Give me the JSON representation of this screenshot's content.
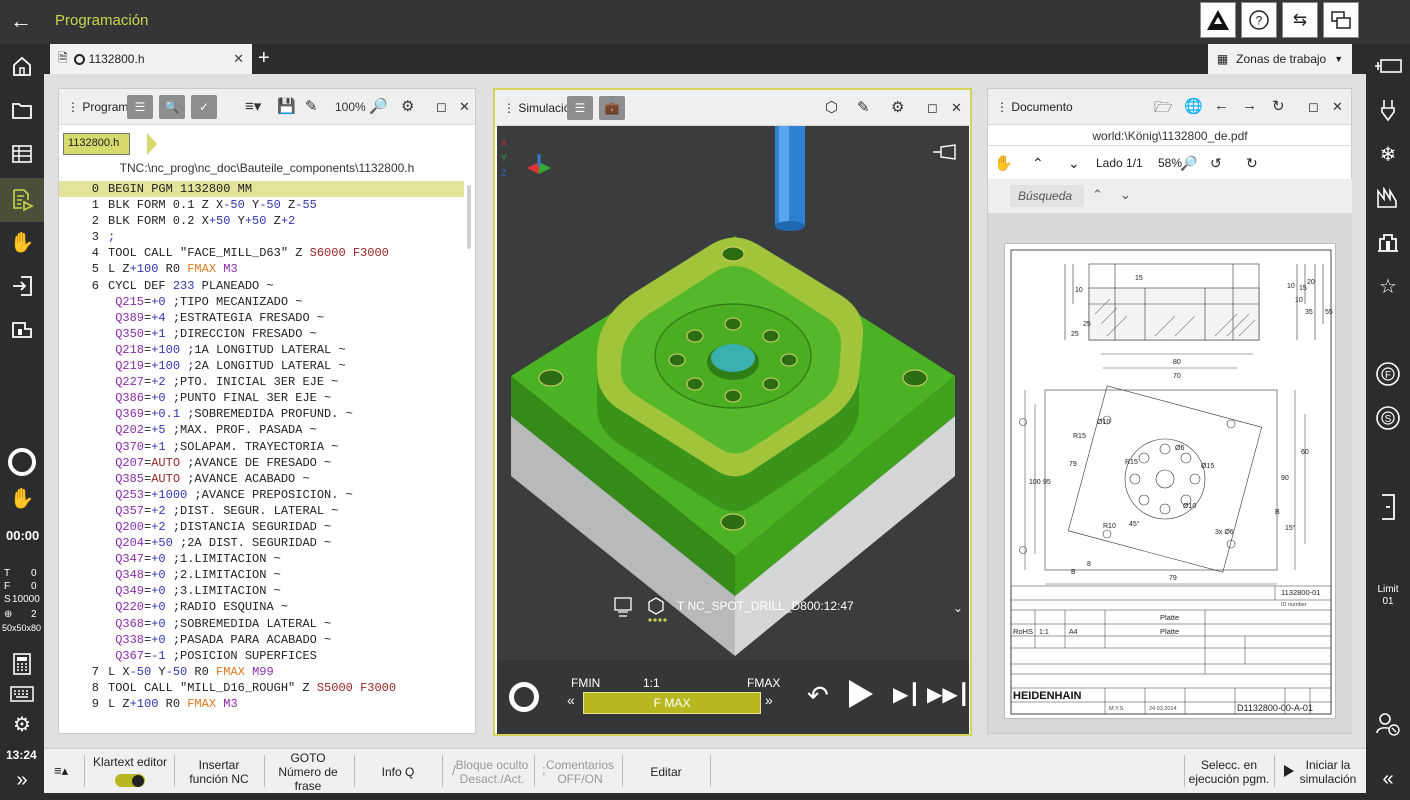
{
  "app": {
    "title": "Programación"
  },
  "topbar": {
    "icons": [
      "warning-triangle-icon",
      "help-icon",
      "transfer-icon",
      "windows-icon"
    ]
  },
  "left_sidebar": {
    "icons": [
      "home-icon",
      "folder-icon",
      "table-icon",
      "editor-icon",
      "hand-icon",
      "run-icon",
      "machine-icon"
    ],
    "timer": "00:00",
    "status": {
      "t_label": "T",
      "t_val": "0",
      "f_label": "F",
      "f_val": "0",
      "s_label": "S",
      "s_val": "10000",
      "blk_icon": "⊕",
      "blk_val": "2",
      "blk_dims": "50x50x80"
    },
    "clock": "13:24"
  },
  "right_sidebar": {
    "limit_label": "Limit",
    "limit_value": "01"
  },
  "tabs": [
    {
      "label": "1132800.h"
    }
  ],
  "workzones": {
    "label": "Zonas de trabajo"
  },
  "program_panel": {
    "title": "Programa",
    "zoom": "100%",
    "breadcrumb": "1132800.h",
    "path": "TNC:\\nc_prog\\nc_doc\\Bauteile_components\\1132800.h",
    "lines": [
      {
        "n": "0",
        "segs": [
          [
            "k",
            "BEGIN PGM 1132800 MM"
          ]
        ],
        "hl": true
      },
      {
        "n": "1",
        "segs": [
          [
            "k",
            "BLK FORM 0.1 Z X"
          ],
          [
            "b",
            "-50"
          ],
          [
            "k",
            " Y"
          ],
          [
            "b",
            "-50"
          ],
          [
            "k",
            " Z"
          ],
          [
            "b",
            "-55"
          ]
        ]
      },
      {
        "n": "2",
        "segs": [
          [
            "k",
            "BLK FORM 0.2 X"
          ],
          [
            "b",
            "+50"
          ],
          [
            "k",
            " Y"
          ],
          [
            "b",
            "+50"
          ],
          [
            "k",
            " Z"
          ],
          [
            "b",
            "+2"
          ]
        ]
      },
      {
        "n": "3",
        "segs": [
          [
            "b",
            ";"
          ]
        ]
      },
      {
        "n": "4",
        "segs": [
          [
            "k",
            "TOOL CALL \"FACE_MILL_D63\" Z "
          ],
          [
            "r",
            "S6000"
          ],
          [
            "k",
            " "
          ],
          [
            "r",
            "F3000"
          ]
        ]
      },
      {
        "n": "5",
        "segs": [
          [
            "k",
            "L Z"
          ],
          [
            "b",
            "+100"
          ],
          [
            "k",
            " R0 "
          ],
          [
            "o",
            "FMAX"
          ],
          [
            "k",
            " "
          ],
          [
            "p",
            "M3"
          ]
        ]
      },
      {
        "n": "6",
        "segs": [
          [
            "k",
            "CYCL DEF "
          ],
          [
            "b",
            "233"
          ],
          [
            "k",
            " PLANEADO ~"
          ]
        ]
      },
      {
        "n": "",
        "segs": [
          [
            "k",
            " "
          ],
          [
            "p",
            "Q215"
          ],
          [
            "k",
            "="
          ],
          [
            "b",
            "+0"
          ],
          [
            "k",
            " ;TIPO MECANIZADO ~"
          ]
        ]
      },
      {
        "n": "",
        "segs": [
          [
            "k",
            " "
          ],
          [
            "p",
            "Q389"
          ],
          [
            "k",
            "="
          ],
          [
            "b",
            "+4"
          ],
          [
            "k",
            " ;ESTRATEGIA FRESADO ~"
          ]
        ]
      },
      {
        "n": "",
        "segs": [
          [
            "k",
            " "
          ],
          [
            "p",
            "Q350"
          ],
          [
            "k",
            "="
          ],
          [
            "b",
            "+1"
          ],
          [
            "k",
            " ;DIRECCION FRESADO ~"
          ]
        ]
      },
      {
        "n": "",
        "segs": [
          [
            "k",
            " "
          ],
          [
            "p",
            "Q218"
          ],
          [
            "k",
            "="
          ],
          [
            "b",
            "+100"
          ],
          [
            "k",
            " ;1A LONGITUD LATERAL ~"
          ]
        ]
      },
      {
        "n": "",
        "segs": [
          [
            "k",
            " "
          ],
          [
            "p",
            "Q219"
          ],
          [
            "k",
            "="
          ],
          [
            "b",
            "+100"
          ],
          [
            "k",
            " ;2A LONGITUD LATERAL ~"
          ]
        ]
      },
      {
        "n": "",
        "segs": [
          [
            "k",
            " "
          ],
          [
            "p",
            "Q227"
          ],
          [
            "k",
            "="
          ],
          [
            "b",
            "+2"
          ],
          [
            "k",
            " ;PTO. INICIAL 3ER EJE ~"
          ]
        ]
      },
      {
        "n": "",
        "segs": [
          [
            "k",
            " "
          ],
          [
            "p",
            "Q386"
          ],
          [
            "k",
            "="
          ],
          [
            "b",
            "+0"
          ],
          [
            "k",
            " ;PUNTO FINAL 3ER EJE ~"
          ]
        ]
      },
      {
        "n": "",
        "segs": [
          [
            "k",
            " "
          ],
          [
            "p",
            "Q369"
          ],
          [
            "k",
            "="
          ],
          [
            "b",
            "+0.1"
          ],
          [
            "k",
            " ;SOBREMEDIDA PROFUND. ~"
          ]
        ]
      },
      {
        "n": "",
        "segs": [
          [
            "k",
            " "
          ],
          [
            "p",
            "Q202"
          ],
          [
            "k",
            "="
          ],
          [
            "b",
            "+5"
          ],
          [
            "k",
            " ;MAX. PROF. PASADA ~"
          ]
        ]
      },
      {
        "n": "",
        "segs": [
          [
            "k",
            " "
          ],
          [
            "p",
            "Q370"
          ],
          [
            "k",
            "="
          ],
          [
            "b",
            "+1"
          ],
          [
            "k",
            " ;SOLAPAM. TRAYECTORIA ~"
          ]
        ]
      },
      {
        "n": "",
        "segs": [
          [
            "k",
            " "
          ],
          [
            "p",
            "Q207"
          ],
          [
            "k",
            "="
          ],
          [
            "r",
            "AUTO"
          ],
          [
            "k",
            " ;AVANCE DE FRESADO ~"
          ]
        ]
      },
      {
        "n": "",
        "segs": [
          [
            "k",
            " "
          ],
          [
            "p",
            "Q385"
          ],
          [
            "k",
            "="
          ],
          [
            "r",
            "AUTO"
          ],
          [
            "k",
            " ;AVANCE ACABADO ~"
          ]
        ]
      },
      {
        "n": "",
        "segs": [
          [
            "k",
            " "
          ],
          [
            "p",
            "Q253"
          ],
          [
            "k",
            "="
          ],
          [
            "b",
            "+1000"
          ],
          [
            "k",
            " ;AVANCE PREPOSICION. ~"
          ]
        ]
      },
      {
        "n": "",
        "segs": [
          [
            "k",
            " "
          ],
          [
            "p",
            "Q357"
          ],
          [
            "k",
            "="
          ],
          [
            "b",
            "+2"
          ],
          [
            "k",
            " ;DIST. SEGUR. LATERAL ~"
          ]
        ]
      },
      {
        "n": "",
        "segs": [
          [
            "k",
            " "
          ],
          [
            "p",
            "Q200"
          ],
          [
            "k",
            "="
          ],
          [
            "b",
            "+2"
          ],
          [
            "k",
            " ;DISTANCIA SEGURIDAD ~"
          ]
        ]
      },
      {
        "n": "",
        "segs": [
          [
            "k",
            " "
          ],
          [
            "p",
            "Q204"
          ],
          [
            "k",
            "="
          ],
          [
            "b",
            "+50"
          ],
          [
            "k",
            " ;2A DIST. SEGURIDAD ~"
          ]
        ]
      },
      {
        "n": "",
        "segs": [
          [
            "k",
            " "
          ],
          [
            "p",
            "Q347"
          ],
          [
            "k",
            "="
          ],
          [
            "b",
            "+0"
          ],
          [
            "k",
            " ;1.LIMITACION ~"
          ]
        ]
      },
      {
        "n": "",
        "segs": [
          [
            "k",
            " "
          ],
          [
            "p",
            "Q348"
          ],
          [
            "k",
            "="
          ],
          [
            "b",
            "+0"
          ],
          [
            "k",
            " ;2.LIMITACION ~"
          ]
        ]
      },
      {
        "n": "",
        "segs": [
          [
            "k",
            " "
          ],
          [
            "p",
            "Q349"
          ],
          [
            "k",
            "="
          ],
          [
            "b",
            "+0"
          ],
          [
            "k",
            " ;3.LIMITACION ~"
          ]
        ]
      },
      {
        "n": "",
        "segs": [
          [
            "k",
            " "
          ],
          [
            "p",
            "Q220"
          ],
          [
            "k",
            "="
          ],
          [
            "b",
            "+0"
          ],
          [
            "k",
            " ;RADIO ESQUINA ~"
          ]
        ]
      },
      {
        "n": "",
        "segs": [
          [
            "k",
            " "
          ],
          [
            "p",
            "Q368"
          ],
          [
            "k",
            "="
          ],
          [
            "b",
            "+0"
          ],
          [
            "k",
            " ;SOBREMEDIDA LATERAL ~"
          ]
        ]
      },
      {
        "n": "",
        "segs": [
          [
            "k",
            " "
          ],
          [
            "p",
            "Q338"
          ],
          [
            "k",
            "="
          ],
          [
            "b",
            "+0"
          ],
          [
            "k",
            " ;PASADA PARA ACABADO ~"
          ]
        ]
      },
      {
        "n": "",
        "segs": [
          [
            "k",
            " "
          ],
          [
            "p",
            "Q367"
          ],
          [
            "k",
            "="
          ],
          [
            "b",
            "-1"
          ],
          [
            "k",
            " ;POSICION SUPERFICES"
          ]
        ]
      },
      {
        "n": "7",
        "segs": [
          [
            "k",
            "L X"
          ],
          [
            "b",
            "-50"
          ],
          [
            "k",
            " Y"
          ],
          [
            "b",
            "-50"
          ],
          [
            "k",
            " R0 "
          ],
          [
            "o",
            "FMAX"
          ],
          [
            "k",
            " "
          ],
          [
            "p",
            "M99"
          ]
        ]
      },
      {
        "n": "8",
        "segs": [
          [
            "k",
            "TOOL CALL \"MILL_D16_ROUGH\" Z "
          ],
          [
            "r",
            "S5000"
          ],
          [
            "k",
            " "
          ],
          [
            "r",
            "F3000"
          ]
        ]
      },
      {
        "n": "9",
        "segs": [
          [
            "k",
            "L Z"
          ],
          [
            "b",
            "+100"
          ],
          [
            "k",
            " R0 "
          ],
          [
            "o",
            "FMAX"
          ],
          [
            "k",
            " "
          ],
          [
            "p",
            "M3"
          ]
        ]
      }
    ]
  },
  "sim_panel": {
    "title": "Simulación",
    "axis_x": "X",
    "axis_y": "Y",
    "axis_z": "Z",
    "tool_info": "T NC_SPOT_DRILL_D8",
    "time": "00:12:47",
    "fmin": "FMIN",
    "ratio": "1:1",
    "fmax": "FMAX",
    "feed": "F MAX",
    "feed_level_pct": 100
  },
  "doc_panel": {
    "title": "Documento",
    "url": "world:\\König\\1132800_de.pdf",
    "page": "Lado 1/1",
    "zoom": "58%",
    "search_placeholder": "Búsqueda",
    "drawing": {
      "dims": [
        "80",
        "70",
        "100",
        "95",
        "79",
        "60",
        "90",
        "R15",
        "R15",
        "Ø10",
        "Ø6",
        "Ø15",
        "Ø10",
        "R10",
        "45°",
        "15°",
        "3x Ø6",
        "B",
        "B",
        "8",
        "79",
        "10",
        "15",
        "25",
        "35",
        "55",
        "25",
        "10",
        "10",
        "15",
        "20"
      ],
      "part_no": "1132800-01",
      "plate1": "Platte",
      "plate2": "Platte",
      "rohs": "RoHS",
      "scale": "1:1",
      "fmt": "A4",
      "dwg_no": "D1132800-00-A-01",
      "brand": "HEIDENHAIN",
      "id_number": "ID number",
      "date1": "M.Y.S",
      "date2": "24.03.2014"
    }
  },
  "bottombar": {
    "klartext": "Klartext editor",
    "insert1": "Insertar",
    "insert2": "función NC",
    "goto1": "GOTO",
    "goto2": "Número de frase",
    "info": "Info Q",
    "hide1": "Bloque oculto",
    "hide2": "Desact./Act.",
    "comm1": "Comentarios",
    "comm2": "OFF/ON",
    "edit": "Editar",
    "sel1": "Selecc. en",
    "sel2": "ejecución pgm.",
    "start1": "Iniciar la",
    "start2": "simulación"
  }
}
